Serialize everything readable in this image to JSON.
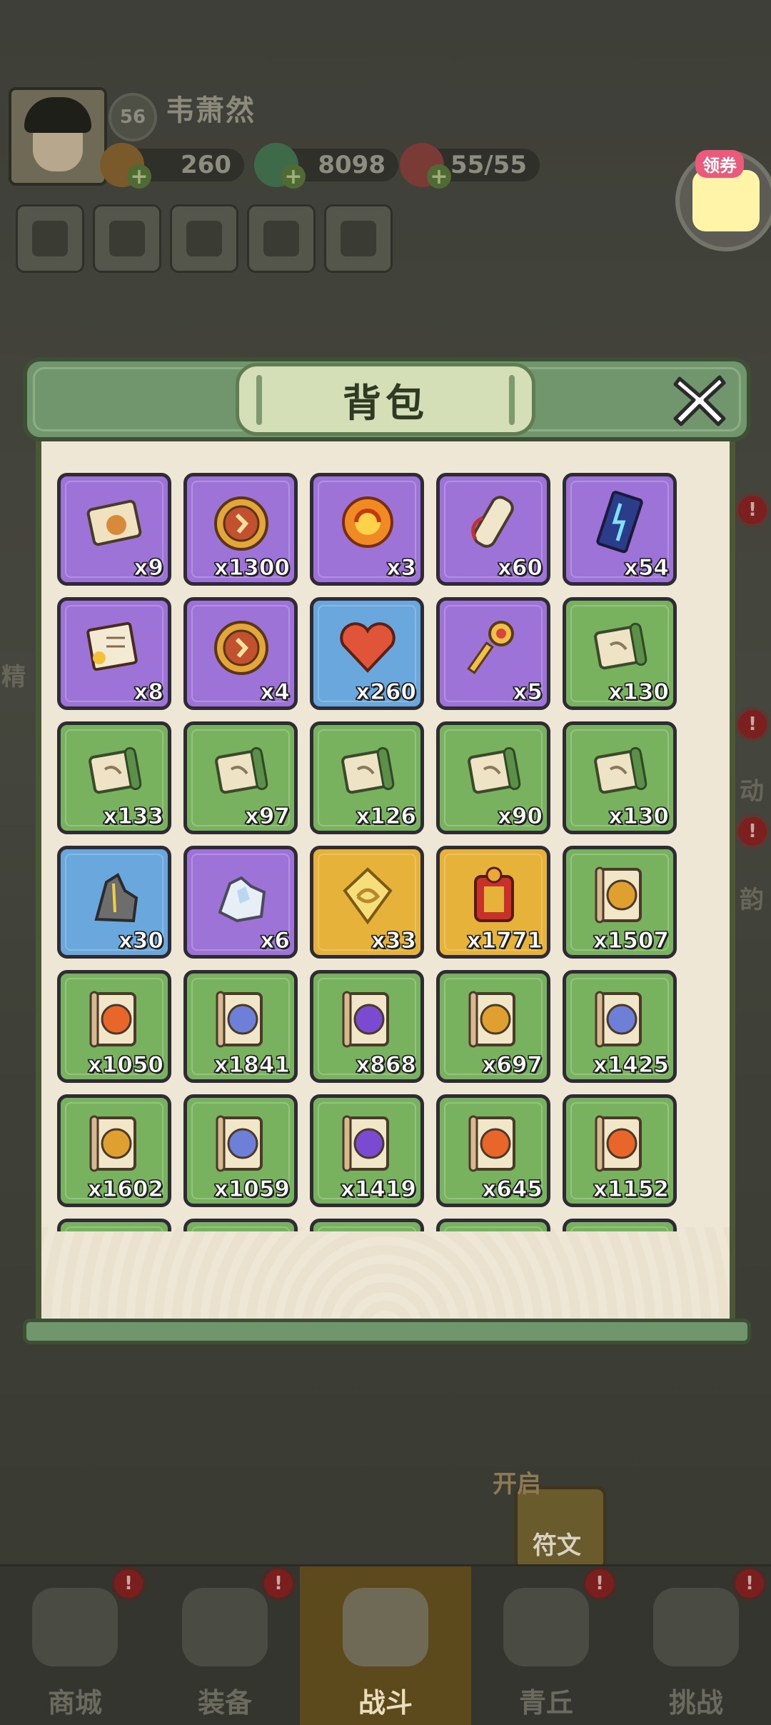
{
  "player": {
    "level": "56",
    "name": "韦萧然"
  },
  "resources": [
    {
      "name": "mushroom-gold",
      "value": "260"
    },
    {
      "name": "dragon-jade",
      "value": "8098"
    },
    {
      "name": "peach-stamina",
      "value": "55/55"
    }
  ],
  "coupon": {
    "label": "领券"
  },
  "side": {
    "left1": "精",
    "right1": "动",
    "right2": "韵"
  },
  "rune": {
    "open_label": "开启",
    "label": "符文"
  },
  "bag": {
    "title": "背包",
    "items": [
      {
        "icon": "scroll-map-icon",
        "rarity": "purple",
        "count": "x9"
      },
      {
        "icon": "gold-coin-icon",
        "rarity": "purple",
        "count": "x1300"
      },
      {
        "icon": "fire-swirl-icon",
        "rarity": "purple",
        "count": "x3"
      },
      {
        "icon": "tied-scroll-icon",
        "rarity": "purple",
        "count": "x60"
      },
      {
        "icon": "lightning-talisman-icon",
        "rarity": "purple",
        "count": "x54"
      },
      {
        "icon": "letter-book-icon",
        "rarity": "purple",
        "count": "x8"
      },
      {
        "icon": "order-token-icon",
        "rarity": "purple",
        "count": "x4"
      },
      {
        "icon": "heart-icon",
        "rarity": "blue",
        "count": "x260"
      },
      {
        "icon": "golden-key-icon",
        "rarity": "purple",
        "count": "x5"
      },
      {
        "icon": "green-scroll-icon",
        "rarity": "green",
        "count": "x130"
      },
      {
        "icon": "green-scroll-icon",
        "rarity": "green",
        "count": "x133"
      },
      {
        "icon": "green-scroll-icon",
        "rarity": "green",
        "count": "x97"
      },
      {
        "icon": "green-scroll-icon",
        "rarity": "green",
        "count": "x126"
      },
      {
        "icon": "green-scroll-icon",
        "rarity": "green",
        "count": "x90"
      },
      {
        "icon": "green-scroll-icon",
        "rarity": "green",
        "count": "x130"
      },
      {
        "icon": "iron-ore-icon",
        "rarity": "blue",
        "count": "x30"
      },
      {
        "icon": "crystal-ore-icon",
        "rarity": "purple",
        "count": "x6"
      },
      {
        "icon": "dragon-plate-icon",
        "rarity": "gold",
        "count": "x33"
      },
      {
        "icon": "points-token-icon",
        "rarity": "gold",
        "count": "x1771"
      },
      {
        "icon": "bird-scroll-icon",
        "rarity": "green",
        "count": "x1507"
      },
      {
        "icon": "fire-skill-scroll-icon",
        "rarity": "green",
        "count": "x1050"
      },
      {
        "icon": "ghost-skill-scroll-icon",
        "rarity": "green",
        "count": "x1841"
      },
      {
        "icon": "thunder-skill-scroll-icon",
        "rarity": "green",
        "count": "x868"
      },
      {
        "icon": "wolf-skill-scroll-icon",
        "rarity": "green",
        "count": "x697"
      },
      {
        "icon": "spirit-skill-scroll-icon",
        "rarity": "green",
        "count": "x1425"
      },
      {
        "icon": "roar-skill-scroll-icon",
        "rarity": "green",
        "count": "x1602"
      },
      {
        "icon": "wind-skill-scroll-icon",
        "rarity": "green",
        "count": "x1059"
      },
      {
        "icon": "slash-skill-scroll-icon",
        "rarity": "green",
        "count": "x1419"
      },
      {
        "icon": "spear-skill-scroll-icon",
        "rarity": "green",
        "count": "x645"
      },
      {
        "icon": "flame-skill-scroll-icon",
        "rarity": "green",
        "count": "x1152"
      },
      {
        "icon": "green-scroll-icon",
        "rarity": "green",
        "count": ""
      },
      {
        "icon": "green-scroll-icon",
        "rarity": "green",
        "count": ""
      },
      {
        "icon": "green-scroll-icon",
        "rarity": "green",
        "count": ""
      },
      {
        "icon": "green-scroll-icon",
        "rarity": "green",
        "count": ""
      },
      {
        "icon": "green-scroll-icon",
        "rarity": "green",
        "count": ""
      }
    ]
  },
  "nav": [
    {
      "label": "商城",
      "icon": "shop-icon",
      "active": false,
      "alert": "!"
    },
    {
      "label": "装备",
      "icon": "helmet-icon",
      "active": false,
      "alert": "!"
    },
    {
      "label": "战斗",
      "icon": "crossed-swords-icon",
      "active": true,
      "alert": ""
    },
    {
      "label": "青丘",
      "icon": "mountain-icon",
      "active": false,
      "alert": "!"
    },
    {
      "label": "挑战",
      "icon": "orb-icon",
      "active": false,
      "alert": "!"
    }
  ],
  "colors": {
    "purple": "#9d73d8",
    "green": "#78b25e",
    "blue": "#6aa7dc",
    "gold": "#e6b23a",
    "frame": "#71956c",
    "paper": "#efe7d6"
  }
}
